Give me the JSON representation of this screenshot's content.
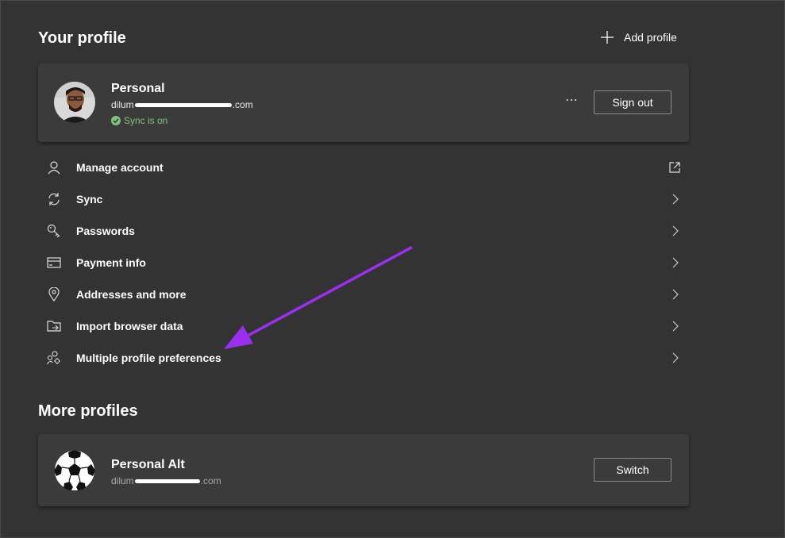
{
  "colors": {
    "background": "#333333",
    "card": "#3b3b3b",
    "sync_green": "#7ec480",
    "annotation_arrow": "#9b2ff0"
  },
  "your_profile": {
    "title": "Your profile",
    "add_profile_label": "Add profile",
    "current": {
      "name": "Personal",
      "email_prefix": "dilum",
      "email_suffix": ".com",
      "sync_status": "Sync is on",
      "more_menu": "⋯",
      "sign_out_label": "Sign out"
    }
  },
  "menu_items": [
    {
      "label": "Manage account",
      "icon": "person-icon",
      "end_icon": "external-link-icon"
    },
    {
      "label": "Sync",
      "icon": "sync-icon",
      "end_icon": "chevron-right-icon"
    },
    {
      "label": "Passwords",
      "icon": "key-icon",
      "end_icon": "chevron-right-icon"
    },
    {
      "label": "Payment info",
      "icon": "credit-card-icon",
      "end_icon": "chevron-right-icon"
    },
    {
      "label": "Addresses and more",
      "icon": "location-pin-icon",
      "end_icon": "chevron-right-icon"
    },
    {
      "label": "Import browser data",
      "icon": "import-folder-icon",
      "end_icon": "chevron-right-icon"
    },
    {
      "label": "Multiple profile preferences",
      "icon": "profiles-settings-icon",
      "end_icon": "chevron-right-icon"
    }
  ],
  "more_profiles": {
    "title": "More profiles",
    "profiles": [
      {
        "name": "Personal Alt",
        "email_prefix": "dilum",
        "email_suffix": ".com",
        "switch_label": "Switch"
      }
    ]
  }
}
